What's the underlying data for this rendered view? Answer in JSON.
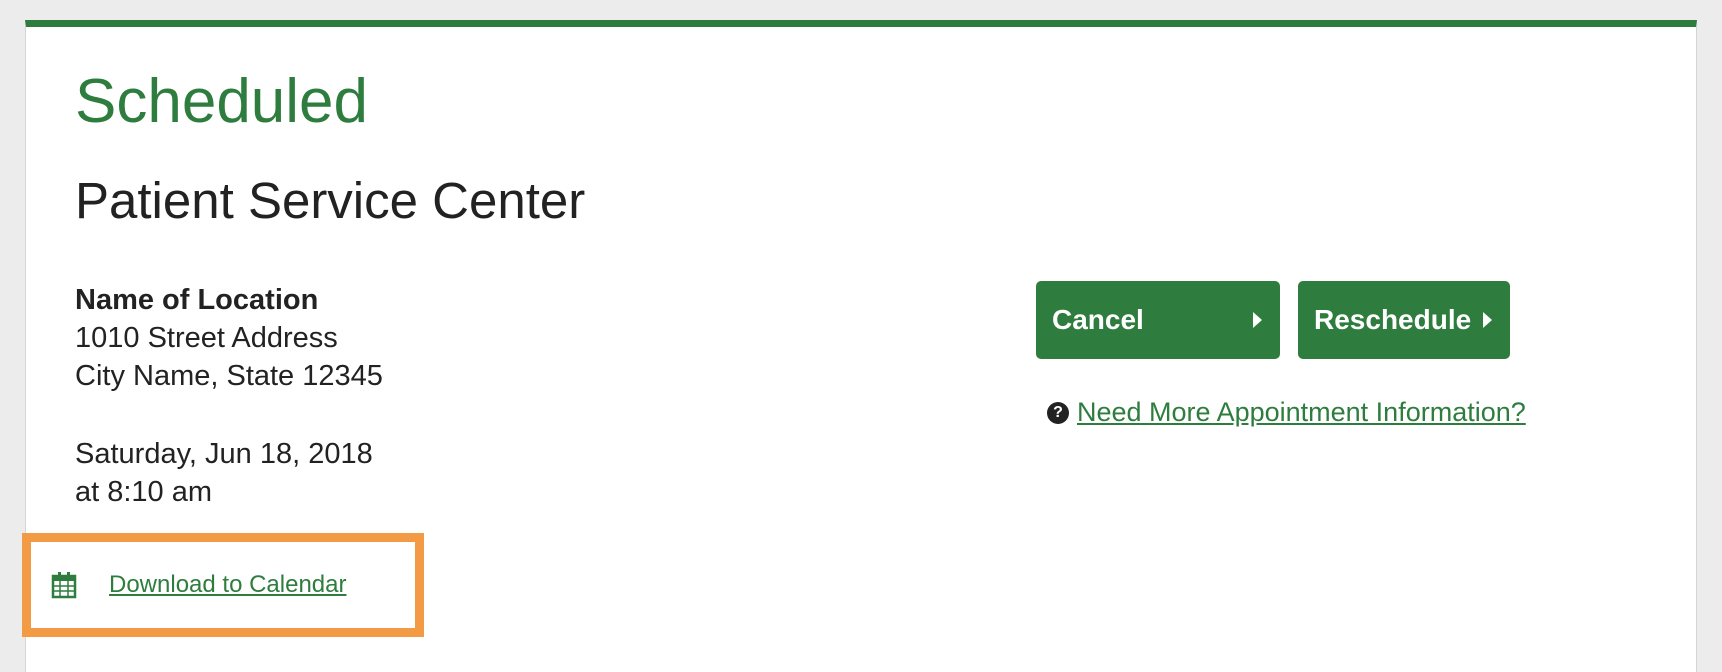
{
  "status": {
    "title": "Scheduled"
  },
  "service": {
    "title": "Patient Service Center"
  },
  "location": {
    "name": "Name of Location",
    "street": "1010 Street Address",
    "city_state_zip": "City Name, State 12345"
  },
  "appointment": {
    "date": "Saturday, Jun 18, 2018",
    "time": "at 8:10 am"
  },
  "actions": {
    "cancel_label": "Cancel",
    "reschedule_label": "Reschedule",
    "help_label": "Need More Appointment Information?",
    "help_icon": "question-circle-icon"
  },
  "calendar": {
    "download_label": "Download to Calendar",
    "icon": "calendar-icon"
  },
  "colors": {
    "brand_green": "#2e7d3e",
    "highlight_orange": "#f39a44"
  }
}
